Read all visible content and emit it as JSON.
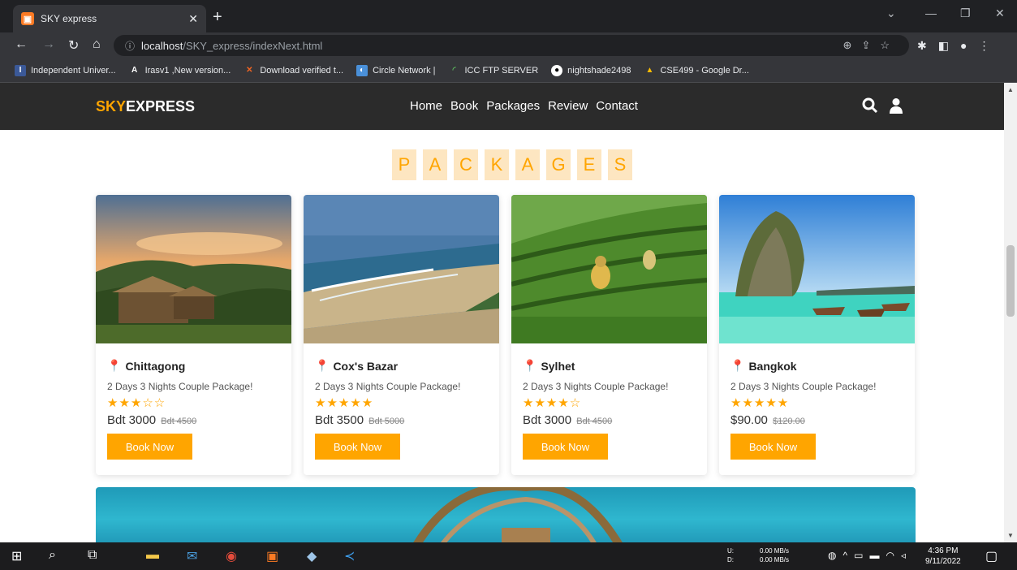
{
  "browser": {
    "tab_title": "SKY express",
    "url_host": "localhost",
    "url_path": "/SKY_express/indexNext.html",
    "bookmarks": [
      {
        "label": "Independent Univer...",
        "icon": "university-icon",
        "color": "#3b5998"
      },
      {
        "label": "Irasv1 ,New version...",
        "icon": "a-icon",
        "color": "#ffffff"
      },
      {
        "label": "Download verified t...",
        "icon": "x-icon",
        "color": "#f26522"
      },
      {
        "label": "Circle Network |",
        "icon": "circle-network-icon",
        "color": "#4a90d9"
      },
      {
        "label": "ICC FTP SERVER",
        "icon": "ftp-icon",
        "color": "#5cb85c"
      },
      {
        "label": "nightshade2498",
        "icon": "github-icon",
        "color": "#ffffff"
      },
      {
        "label": "CSE499 - Google Dr...",
        "icon": "google-drive-icon",
        "color": "#fbbc04"
      }
    ]
  },
  "site": {
    "logo_accent": "SKY",
    "logo_rest": "EXPRESS",
    "nav": [
      "Home",
      "Book",
      "Packages",
      "Review",
      "Contact"
    ],
    "heading_letters": [
      "P",
      "A",
      "C",
      "K",
      "A",
      "G",
      "E",
      "S"
    ],
    "accent_color": "#ffa500"
  },
  "packages": [
    {
      "place": "Chittagong",
      "desc": "2 Days 3 Nights Couple Package!",
      "stars": "★★★☆☆",
      "price": "Bdt 3000",
      "old_price": "Bdt 4500",
      "button": "Book Now"
    },
    {
      "place": "Cox's Bazar",
      "desc": "2 Days 3 Nights Couple Package!",
      "stars": "★★★★★",
      "price": "Bdt 3500",
      "old_price": "Bdt 5000",
      "button": "Book Now"
    },
    {
      "place": "Sylhet",
      "desc": "2 Days 3 Nights Couple Package!",
      "stars": "★★★★☆",
      "price": "Bdt 3000",
      "old_price": "Bdt 4500",
      "button": "Book Now"
    },
    {
      "place": "Bangkok",
      "desc": "2 Days 3 Nights Couple Package!",
      "stars": "★★★★★",
      "price": "$90.00",
      "old_price": "$120.00",
      "button": "Book Now"
    }
  ],
  "taskbar": {
    "net_u": "U:",
    "net_d": "D:",
    "speed_u": "0.00 MB/s",
    "speed_d": "0.00 MB/s",
    "time": "4:36 PM",
    "date": "9/11/2022"
  }
}
